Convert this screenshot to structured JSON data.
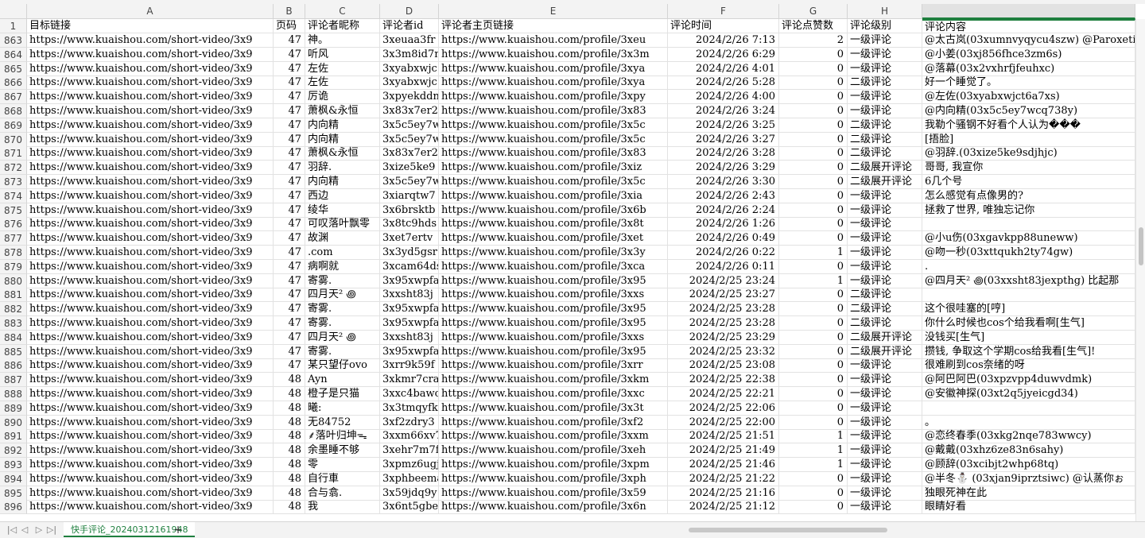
{
  "columns": [
    {
      "letter": "A",
      "header": "目标链接"
    },
    {
      "letter": "B",
      "header": "页码"
    },
    {
      "letter": "C",
      "header": "评论者昵称"
    },
    {
      "letter": "D",
      "header": "评论者id"
    },
    {
      "letter": "E",
      "header": "评论者主页链接"
    },
    {
      "letter": "F",
      "header": "评论时间"
    },
    {
      "letter": "G",
      "header": "评论点赞数"
    },
    {
      "letter": "H",
      "header": "评论级别"
    },
    {
      "letter": "",
      "header": "评论内容"
    }
  ],
  "header_row_number": "1",
  "rows": [
    [
      "863",
      "https://www.kuaishou.com/short-video/3x9",
      "47",
      "神。",
      "3xeuaa3fr",
      "https://www.kuaishou.com/profile/3xeu",
      "2024/2/26 7:13",
      "2",
      "一级评论",
      "@太古岚(03xumnvyqycu4szw) @Paroxeti"
    ],
    [
      "864",
      "https://www.kuaishou.com/short-video/3x9",
      "47",
      "听风",
      "3x3m8id7m",
      "https://www.kuaishou.com/profile/3x3m",
      "2024/2/26 6:29",
      "0",
      "一级评论",
      "@小姜(03xj856fhce3zm6s)"
    ],
    [
      "865",
      "https://www.kuaishou.com/short-video/3x9",
      "47",
      "左佐",
      "3xyabxwjc",
      "https://www.kuaishou.com/profile/3xya",
      "2024/2/26 4:01",
      "0",
      "一级评论",
      "@落幕(03x2vxhrfjfeuhxc)"
    ],
    [
      "866",
      "https://www.kuaishou.com/short-video/3x9",
      "47",
      "左佐",
      "3xyabxwjc",
      "https://www.kuaishou.com/profile/3xya",
      "2024/2/26 5:28",
      "0",
      "二级评论",
      "好一个睡觉了。"
    ],
    [
      "867",
      "https://www.kuaishou.com/short-video/3x9",
      "47",
      "厉诡",
      "3xpyekddn",
      "https://www.kuaishou.com/profile/3xpy",
      "2024/2/26 4:00",
      "0",
      "一级评论",
      "@左佐(03xyabxwjct6a7xs)"
    ],
    [
      "868",
      "https://www.kuaishou.com/short-video/3x9",
      "47",
      "萧枫&永恒",
      "3x83x7er2",
      "https://www.kuaishou.com/profile/3x83",
      "2024/2/26 3:24",
      "0",
      "一级评论",
      "@内向精(03x5c5ey7wcq738y)"
    ],
    [
      "869",
      "https://www.kuaishou.com/short-video/3x9",
      "47",
      "内向精",
      "3x5c5ey7w",
      "https://www.kuaishou.com/profile/3x5c",
      "2024/2/26 3:25",
      "0",
      "二级评论",
      "我勒个骚钢不好看个人认为���"
    ],
    [
      "870",
      "https://www.kuaishou.com/short-video/3x9",
      "47",
      "内向精",
      "3x5c5ey7w",
      "https://www.kuaishou.com/profile/3x5c",
      "2024/2/26 3:27",
      "0",
      "二级评论",
      "[捂脸]"
    ],
    [
      "871",
      "https://www.kuaishou.com/short-video/3x9",
      "47",
      "萧枫&永恒",
      "3x83x7er2",
      "https://www.kuaishou.com/profile/3x83",
      "2024/2/26 3:28",
      "0",
      "二级评论",
      "@羽辞.(03xize5ke9sdjhjc)"
    ],
    [
      "872",
      "https://www.kuaishou.com/short-video/3x9",
      "47",
      "羽辞.",
      "3xize5ke9",
      "https://www.kuaishou.com/profile/3xiz",
      "2024/2/26 3:29",
      "0",
      "二级展开评论",
      "哥哥, 我宣你"
    ],
    [
      "873",
      "https://www.kuaishou.com/short-video/3x9",
      "47",
      "内向精",
      "3x5c5ey7w",
      "https://www.kuaishou.com/profile/3x5c",
      "2024/2/26 3:30",
      "0",
      "二级展开评论",
      "6几个号"
    ],
    [
      "874",
      "https://www.kuaishou.com/short-video/3x9",
      "47",
      "西边",
      "3xiarqtw7",
      "https://www.kuaishou.com/profile/3xia",
      "2024/2/26 2:43",
      "0",
      "一级评论",
      "怎么感觉有点像男的?"
    ],
    [
      "875",
      "https://www.kuaishou.com/short-video/3x9",
      "47",
      "绫华",
      "3x6brsktb",
      "https://www.kuaishou.com/profile/3x6b",
      "2024/2/26 2:24",
      "0",
      "一级评论",
      "拯救了世界, 唯独忘记你"
    ],
    [
      "876",
      "https://www.kuaishou.com/short-video/3x9",
      "47",
      "可叹落叶飘零",
      "3x8tc9hds",
      "https://www.kuaishou.com/profile/3x8t",
      "2024/2/26 1:26",
      "0",
      "一级评论",
      ""
    ],
    [
      "877",
      "https://www.kuaishou.com/short-video/3x9",
      "47",
      "故渊",
      "3xet7ertv",
      "https://www.kuaishou.com/profile/3xet",
      "2024/2/26 0:49",
      "0",
      "一级评论",
      "@小u伤(03xgavkpp88uneww)"
    ],
    [
      "878",
      "https://www.kuaishou.com/short-video/3x9",
      "47",
      ".com",
      "3x3yd5gsr",
      "https://www.kuaishou.com/profile/3x3y",
      "2024/2/26 0:22",
      "1",
      "一级评论",
      "@吻一秒(03xttqukh2ty74gw)"
    ],
    [
      "879",
      "https://www.kuaishou.com/short-video/3x9",
      "47",
      "病啊就",
      "3xcam64ds",
      "https://www.kuaishou.com/profile/3xca",
      "2024/2/26 0:11",
      "0",
      "一级评论",
      "."
    ],
    [
      "880",
      "https://www.kuaishou.com/short-video/3x9",
      "47",
      "寄雾.",
      "3x95xwpfa",
      "https://www.kuaishou.com/profile/3x95",
      "2024/2/25 23:24",
      "1",
      "一级评论",
      "@四月天² ꩜(03xxsht83jexpthg) 比起那"
    ],
    [
      "881",
      "https://www.kuaishou.com/short-video/3x9",
      "47",
      "四月天² ꩜",
      "3xxsht83j",
      "https://www.kuaishou.com/profile/3xxs",
      "2024/2/25 23:27",
      "0",
      "二级评论",
      ""
    ],
    [
      "882",
      "https://www.kuaishou.com/short-video/3x9",
      "47",
      "寄雾.",
      "3x95xwpfa",
      "https://www.kuaishou.com/profile/3x95",
      "2024/2/25 23:28",
      "0",
      "二级评论",
      "这个很哇塞的[哼]"
    ],
    [
      "883",
      "https://www.kuaishou.com/short-video/3x9",
      "47",
      "寄雾.",
      "3x95xwpfa",
      "https://www.kuaishou.com/profile/3x95",
      "2024/2/25 23:28",
      "0",
      "二级评论",
      "你什么时候也cos个给我看啊[生气]"
    ],
    [
      "884",
      "https://www.kuaishou.com/short-video/3x9",
      "47",
      "四月天² ꩜",
      "3xxsht83j",
      "https://www.kuaishou.com/profile/3xxs",
      "2024/2/25 23:29",
      "0",
      "二级展开评论",
      "没钱买[生气]"
    ],
    [
      "885",
      "https://www.kuaishou.com/short-video/3x9",
      "47",
      "寄雾.",
      "3x95xwpfa",
      "https://www.kuaishou.com/profile/3x95",
      "2024/2/25 23:32",
      "0",
      "二级展开评论",
      "攒钱, 争取这个学期cos给我看[生气]!"
    ],
    [
      "886",
      "https://www.kuaishou.com/short-video/3x9",
      "47",
      "某只望仔ovo",
      "3xrr9k59f",
      "https://www.kuaishou.com/profile/3xrr",
      "2024/2/25 23:08",
      "0",
      "一级评论",
      "很难刷到cos奈绪的呀"
    ],
    [
      "887",
      "https://www.kuaishou.com/short-video/3x9",
      "48",
      "Ayn",
      "3xkmr7cra",
      "https://www.kuaishou.com/profile/3xkm",
      "2024/2/25 22:38",
      "0",
      "一级评论",
      "@阿巴阿巴(03xpzvpp4duwvdmk)"
    ],
    [
      "888",
      "https://www.kuaishou.com/short-video/3x9",
      "48",
      "橙子是只猫",
      "3xxc4bawc",
      "https://www.kuaishou.com/profile/3xxc",
      "2024/2/25 22:21",
      "0",
      "一级评论",
      "@安徽神探(03xt2q5jyeicgd34)"
    ],
    [
      "889",
      "https://www.kuaishou.com/short-video/3x9",
      "48",
      "曦:",
      "3x3tmqyfk",
      "https://www.kuaishou.com/profile/3x3t",
      "2024/2/25 22:06",
      "0",
      "一级评论",
      ""
    ],
    [
      "890",
      "https://www.kuaishou.com/short-video/3x9",
      "48",
      "无84752",
      "3xf2zdry3",
      "https://www.kuaishou.com/profile/3xf2",
      "2024/2/25 22:00",
      "0",
      "一级评论",
      "。"
    ],
    [
      "891",
      "https://www.kuaishou.com/short-video/3x9",
      "48",
      "⸙落叶归坤ᯓ",
      "3xxm66xv7",
      "https://www.kuaishou.com/profile/3xxm",
      "2024/2/25 21:51",
      "1",
      "一级评论",
      "@恋终春季(03xkg2nqe783wwcy)"
    ],
    [
      "892",
      "https://www.kuaishou.com/short-video/3x9",
      "48",
      "余墨睡不够",
      "3xehr7m7f",
      "https://www.kuaishou.com/profile/3xeh",
      "2024/2/25 21:49",
      "1",
      "一级评论",
      "@戴戴(03xhz6ze83n6sahy)"
    ],
    [
      "893",
      "https://www.kuaishou.com/short-video/3x9",
      "48",
      "零",
      "3xpmz6ugj",
      "https://www.kuaishou.com/profile/3xpm",
      "2024/2/25 21:46",
      "1",
      "一级评论",
      "@顾辞(03xcibjt2whp68tq)"
    ],
    [
      "894",
      "https://www.kuaishou.com/short-video/3x9",
      "48",
      "自行車",
      "3xphbeema",
      "https://www.kuaishou.com/profile/3xph",
      "2024/2/25 21:22",
      "0",
      "一级评论",
      "@半冬⛄ (03xjan9iprztsiwc) @认蒸你ぉ"
    ],
    [
      "895",
      "https://www.kuaishou.com/short-video/3x9",
      "48",
      "合与翕.",
      "3x59jdq9y",
      "https://www.kuaishou.com/profile/3x59",
      "2024/2/25 21:16",
      "0",
      "一级评论",
      "独眼死神在此"
    ],
    [
      "896",
      "https://www.kuaishou.com/short-video/3x9",
      "48",
      "我",
      "3x6nt5gbe",
      "https://www.kuaishou.com/profile/3x6n",
      "2024/2/25 21:12",
      "0",
      "一级评论",
      "眼睛好看"
    ]
  ],
  "sheet_tab": "快手评论_20240312161948",
  "nav": {
    "first": "|◁",
    "prev": "◁",
    "next": "▷",
    "last": "▷|",
    "add": "+"
  },
  "colors": {
    "accent": "#1e7f3e",
    "header_bg": "#f3f3f3",
    "grid": "#e2e2e2"
  }
}
